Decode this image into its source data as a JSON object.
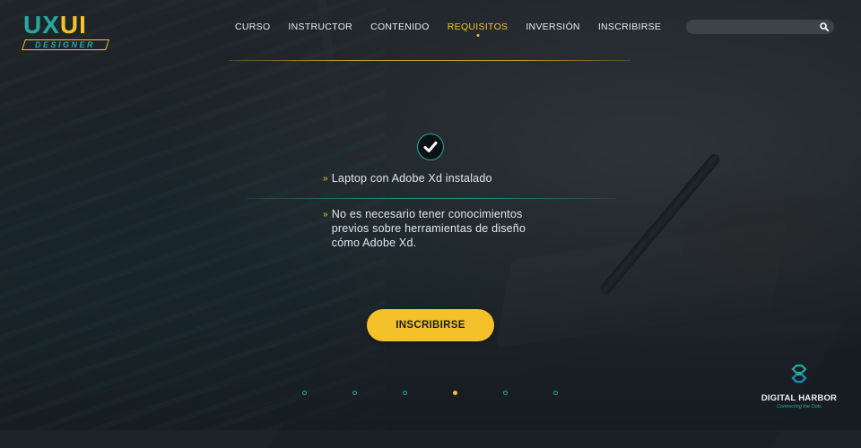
{
  "logo": {
    "top_left": "UX",
    "top_right": "UI",
    "subtitle": "DESIGNER"
  },
  "nav": {
    "items": [
      {
        "label": "CURSO",
        "active": false
      },
      {
        "label": "INSTRUCTOR",
        "active": false
      },
      {
        "label": "CONTENIDO",
        "active": false
      },
      {
        "label": "REQUISITOS",
        "active": true
      },
      {
        "label": "INVERSIÓN",
        "active": false
      },
      {
        "label": "INSCRIBIRSE",
        "active": false
      }
    ]
  },
  "search": {
    "placeholder": "",
    "value": "",
    "icon": "search-icon"
  },
  "requirements": {
    "icon": "check-circle-icon",
    "items": [
      "Laptop con Adobe Xd instalado",
      "No es necesario tener conocimientos previos sobre herramientas de diseño cómo Adobe Xd."
    ],
    "bullet": "»"
  },
  "cta": {
    "label": "INSCRIBIRSE"
  },
  "slider": {
    "count": 6,
    "active_index": 3
  },
  "brand": {
    "name": "DIGITAL HARBOR",
    "tagline": "Connecting the Dots"
  },
  "colors": {
    "accent": "#f4c12a",
    "teal": "#2aa7a0",
    "background": "#1c2226"
  }
}
